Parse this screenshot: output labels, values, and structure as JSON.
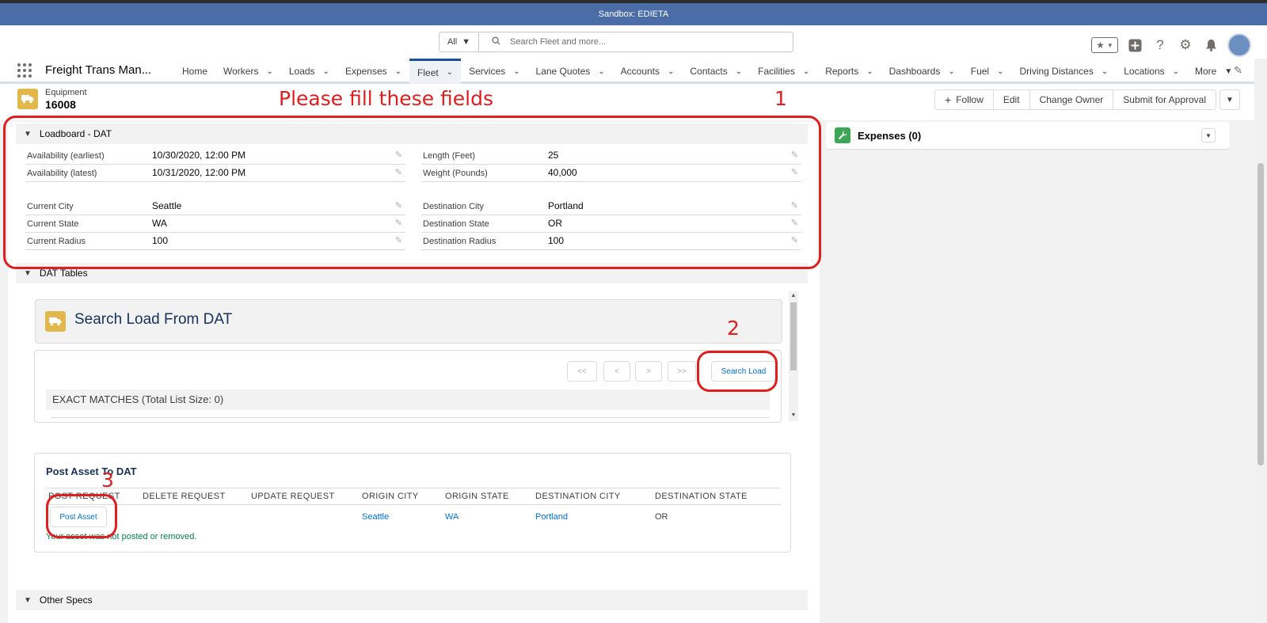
{
  "window": {
    "sandbox_label": "Sandbox: EDIETA"
  },
  "search": {
    "scope": "All",
    "placeholder": "Search Fleet and more..."
  },
  "nav": {
    "app_name": "Freight Trans Man...",
    "items": [
      {
        "label": "Home",
        "has_menu": false
      },
      {
        "label": "Workers",
        "has_menu": true
      },
      {
        "label": "Loads",
        "has_menu": true
      },
      {
        "label": "Expenses",
        "has_menu": true
      },
      {
        "label": "Fleet",
        "has_menu": true,
        "active": true
      },
      {
        "label": "Services",
        "has_menu": true
      },
      {
        "label": "Lane Quotes",
        "has_menu": true
      },
      {
        "label": "Accounts",
        "has_menu": true
      },
      {
        "label": "Contacts",
        "has_menu": true
      },
      {
        "label": "Facilities",
        "has_menu": true
      },
      {
        "label": "Reports",
        "has_menu": true
      },
      {
        "label": "Dashboards",
        "has_menu": true
      },
      {
        "label": "Fuel",
        "has_menu": true
      },
      {
        "label": "Driving Distances",
        "has_menu": true
      },
      {
        "label": "Locations",
        "has_menu": true
      },
      {
        "label": "More",
        "has_menu": true
      }
    ]
  },
  "record": {
    "type_label": "Equipment",
    "name": "16008",
    "actions": {
      "follow": "Follow",
      "edit": "Edit",
      "change_owner": "Change Owner",
      "submit": "Submit for Approval"
    }
  },
  "annotations": {
    "note": "Please fill these fields",
    "n1": "1",
    "n2": "2",
    "n3": "3",
    "color": "#e01e1e"
  },
  "loadboard": {
    "title": "Loadboard - DAT",
    "left": {
      "avail_earliest": {
        "label": "Availability (earliest)",
        "value": "10/30/2020, 12:00 PM"
      },
      "avail_latest": {
        "label": "Availability (latest)",
        "value": "10/31/2020, 12:00 PM"
      },
      "current_city": {
        "label": "Current City",
        "value": "Seattle"
      },
      "current_state": {
        "label": "Current State",
        "value": "WA"
      },
      "current_radius": {
        "label": "Current Radius",
        "value": "100"
      }
    },
    "right": {
      "length": {
        "label": "Length (Feet)",
        "value": "25"
      },
      "weight": {
        "label": "Weight (Pounds)",
        "value": "40,000"
      },
      "dest_city": {
        "label": "Destination City",
        "value": "Portland"
      },
      "dest_state": {
        "label": "Destination State",
        "value": "OR"
      },
      "dest_radius": {
        "label": "Destination Radius",
        "value": "100"
      }
    }
  },
  "dat_tables": {
    "title": "DAT Tables",
    "search_card_title": "Search Load From DAT",
    "pager": {
      "first": "<<",
      "prev": "<",
      "next": ">",
      "last": ">>"
    },
    "search_button": "Search Load",
    "exact_matches": "EXACT MATCHES (Total List Size: 0)"
  },
  "post_asset": {
    "title": "Post Asset To DAT",
    "columns": [
      "POST REQUEST",
      "DELETE REQUEST",
      "UPDATE REQUEST",
      "ORIGIN CITY",
      "ORIGIN STATE",
      "DESTINATION CITY",
      "DESTINATION STATE"
    ],
    "row": {
      "button": "Post Asset",
      "origin_city": "Seattle",
      "origin_state": "WA",
      "destination_city": "Portland",
      "destination_state": "OR"
    },
    "status": "Your asset was not posted or removed."
  },
  "other_specs": {
    "title": "Other Specs"
  },
  "sidebar": {
    "expenses_title": "Expenses (0)"
  },
  "colors": {
    "brand_blue": "#16325c",
    "link": "#0070d2",
    "equipment_icon": "#e2b84a",
    "expenses_icon": "#3ba755",
    "success": "#04844b"
  }
}
